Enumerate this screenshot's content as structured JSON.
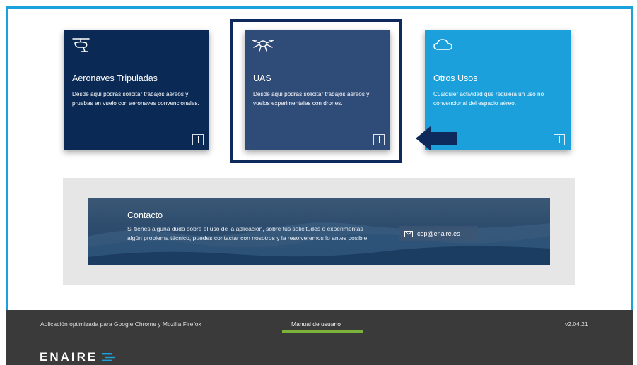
{
  "cards": [
    {
      "title": "Aeronaves Tripuladas",
      "description": "Desde aquí podrás solicitar trabajos aéreos y pruebas en vuelo con aeronaves convencionales.",
      "icon": "helicopter-icon"
    },
    {
      "title": "UAS",
      "description": "Desde aquí podrás solicitar trabajos aéreos y vuelos experimentales con drones.",
      "icon": "drone-icon"
    },
    {
      "title": "Otros Usos",
      "description": "Cualquier actividad que requiera un uso no convencional del espacio aéreo.",
      "icon": "cloud-icon"
    }
  ],
  "contact": {
    "title": "Contacto",
    "text": "Si tienes alguna duda sobre el uso de la aplicación, sobre tus solicitudes o experimentas algún problema técnico, puedes contactar con nosotros y la resolveremos lo antes posible.",
    "email": "cop@enaire.es"
  },
  "footer": {
    "optimized": "Aplicación optimizada para Google Chrome y Mozilla Firefox",
    "manual": "Manual de usuario",
    "version": "v2.04.21",
    "logo": "ENAIRE"
  },
  "colors": {
    "accent": "#1ba0dc",
    "card_dark": "#0a2a55",
    "card_mid": "#2f4b78",
    "highlight": "#0e2a5c",
    "footer_bg": "#3a3a3a",
    "underline": "#7ab23a"
  }
}
